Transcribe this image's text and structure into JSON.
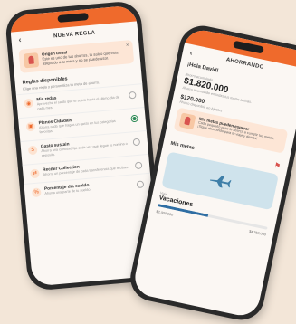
{
  "left": {
    "header_title": "NUEVA REGLA",
    "info_card": {
      "title": "Origen usual",
      "text": "Este es uno de tus ahorros, tu saldo que esta asignado a tu meta y no se puede usar."
    },
    "section_title": "Reglas disponibles",
    "section_subtitle": "Elige una regla y personaliza tu meta de ahorro.",
    "rules": [
      {
        "title": "Mis redas",
        "desc": "Aprovecha el saldo que te sobra hasta el ultimo dia de cada mes.",
        "selected": false
      },
      {
        "title": "Plenos Cidadais",
        "desc": "Ahorra cada que hagas un gasto en tus categorias favoritas.",
        "selected": true
      },
      {
        "title": "Gasto sustain",
        "desc": "Ahorra una cantidad fija cada vez que llegue tu nomina o deposito.",
        "selected": false
      },
      {
        "title": "Recibir Collection",
        "desc": "Ahorra un porcentaje de cada transferencia que recibas.",
        "selected": false
      },
      {
        "title": "Porcentaje dia sueldo",
        "desc": "Ahorra una parte de tu sueldo.",
        "selected": false
      }
    ]
  },
  "right": {
    "header_title": "AHORRANDO",
    "greeting": "¡Hola David!",
    "balance_label": "Ahorro acumulado",
    "balance": "$1.820.000",
    "balance_sub": "Ahorro acumulado en todas tus metas activas.",
    "secondary_amount": "$120.000",
    "secondary_sub": "Ahorro disponible en Ajustes",
    "banner": {
      "title": "Mis metas pueden esperar",
      "text": "Cada pequeño paso te acerca a cumplir tus metas. ¡Sigue ahorrando para tu viaje y demas!"
    },
    "goals_title": "Mis metas",
    "goal": {
      "label": "Viaje",
      "name": "Vacaciones",
      "current": "$2.000.000",
      "target": "$4.350.000",
      "progress": 0.46
    }
  }
}
